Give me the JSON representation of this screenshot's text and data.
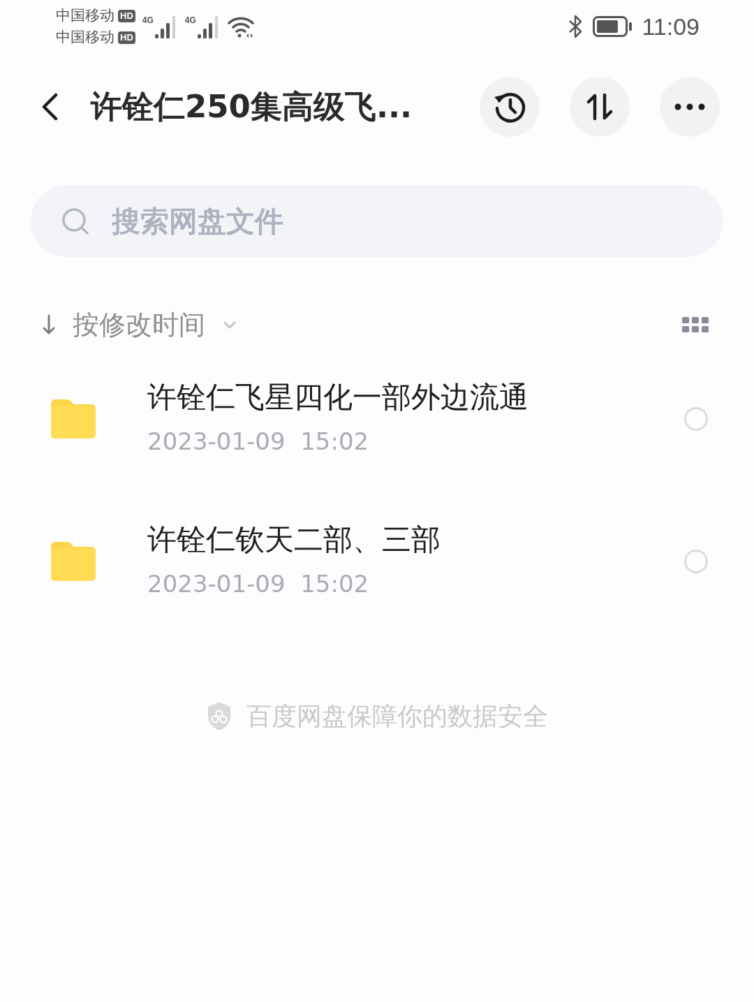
{
  "status_bar": {
    "carriers": [
      {
        "name": "中国移动",
        "badge": "HD"
      },
      {
        "name": "中国移动",
        "badge": "HD"
      }
    ],
    "networks": [
      {
        "label": "4G"
      },
      {
        "label": "4G"
      }
    ],
    "time": "11:09"
  },
  "header": {
    "title": "许铨仁250集高级飞...",
    "actions": [
      {
        "kind": "history"
      },
      {
        "kind": "sort"
      },
      {
        "kind": "more"
      }
    ]
  },
  "search": {
    "placeholder": "搜索网盘文件"
  },
  "sort_bar": {
    "label": "按修改时间"
  },
  "files": [
    {
      "name": "许铨仁飞星四化一部外边流通",
      "modified": "2023-01-09  15:02",
      "selected": false
    },
    {
      "name": "许铨仁钦天二部、三部",
      "modified": "2023-01-09  15:02",
      "selected": false
    }
  ],
  "footer": {
    "text": "百度网盘保障你的数据安全"
  }
}
